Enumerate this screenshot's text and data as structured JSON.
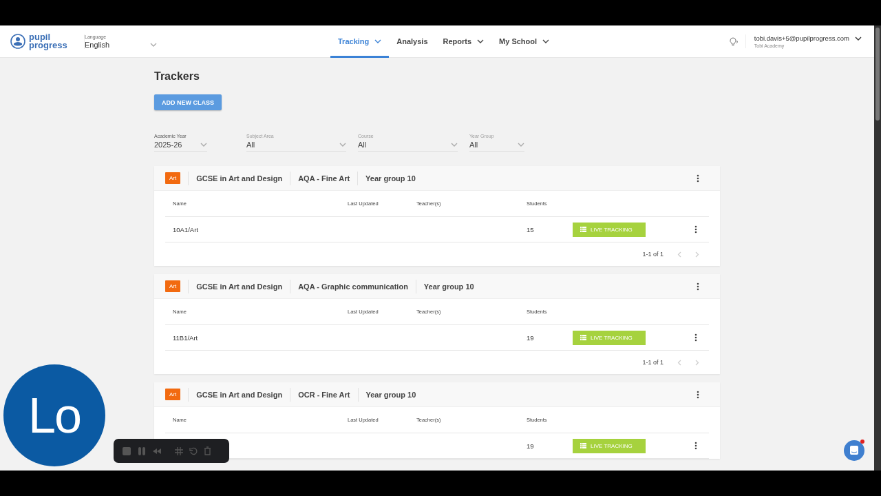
{
  "header": {
    "logo": {
      "line1": "pupil",
      "line2": "progress"
    },
    "language": {
      "label": "Language",
      "value": "English"
    },
    "nav": [
      {
        "label": "Tracking",
        "selected": true,
        "dropdown": true
      },
      {
        "label": "Analysis",
        "selected": false,
        "dropdown": false
      },
      {
        "label": "Reports",
        "selected": false,
        "dropdown": true
      },
      {
        "label": "My School",
        "selected": false,
        "dropdown": true
      }
    ],
    "user": {
      "email": "tobi.davis+5@pupilprogress.com",
      "school": "Tobi Academy"
    }
  },
  "page": {
    "title": "Trackers",
    "add_button": "ADD NEW CLASS",
    "filters": [
      {
        "label": "Academic Year",
        "value": "2025-26",
        "filled": true
      },
      {
        "label": "Subject Area",
        "value": "All",
        "filled": false
      },
      {
        "label": "Course",
        "value": "All",
        "filled": false
      },
      {
        "label": "Year Group",
        "value": "All",
        "filled": false
      }
    ],
    "trackers": [
      {
        "tag": "Art",
        "color": "#f26a10",
        "course": "GCSE in Art and Design",
        "board": "AQA - Fine Art",
        "year_group": "Year group 10",
        "columns": [
          "Name",
          "Last Updated",
          "Teacher(s)",
          "Students"
        ],
        "rows": [
          {
            "name": "10A1/Art",
            "students": "15",
            "action": "LIVE TRACKING"
          }
        ],
        "pagination": "1-1 of 1"
      },
      {
        "tag": "Art",
        "color": "#f26a10",
        "course": "GCSE in Art and Design",
        "board": "AQA - Graphic communication",
        "year_group": "Year group 10",
        "columns": [
          "Name",
          "Last Updated",
          "Teacher(s)",
          "Students"
        ],
        "rows": [
          {
            "name": "11B1/Art",
            "students": "19",
            "action": "LIVE TRACKING"
          }
        ],
        "pagination": "1-1 of 1"
      },
      {
        "tag": "Art",
        "color": "#f26a10",
        "course": "GCSE in Art and Design",
        "board": "OCR - Fine Art",
        "year_group": "Year group 10",
        "columns": [
          "Name",
          "Last Updated",
          "Teacher(s)",
          "Students"
        ],
        "rows": [
          {
            "students": "19",
            "action": "LIVE TRACKING"
          }
        ]
      }
    ]
  },
  "overlays": {
    "avatar": {
      "initials": "Lo"
    },
    "chat": {
      "unread": true
    }
  }
}
